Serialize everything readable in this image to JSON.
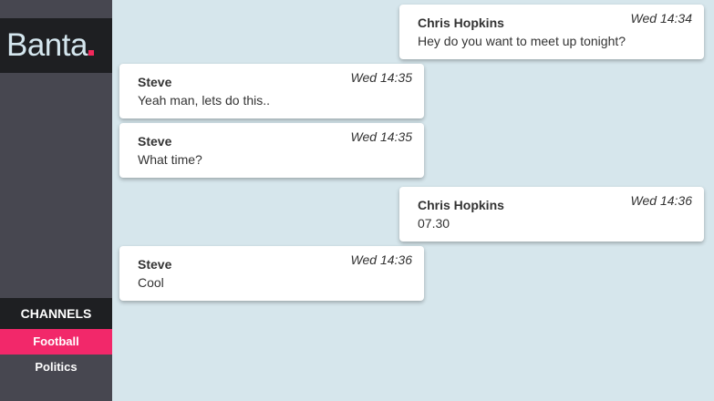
{
  "app": {
    "logo": "Banta",
    "logo_dot_color": "#f2285b"
  },
  "sidebar": {
    "channels_header": "CHANNELS",
    "channels": [
      {
        "label": "Football",
        "active": true
      },
      {
        "label": "Politics",
        "active": false
      }
    ]
  },
  "messages": [
    {
      "author": "Chris Hopkins",
      "time": "Wed 14:34",
      "text": "Hey do you want to meet up tonight?",
      "side": "right"
    },
    {
      "author": "Steve",
      "time": "Wed 14:35",
      "text": "Yeah man, lets do this..",
      "side": "left"
    },
    {
      "author": "Steve",
      "time": "Wed 14:35",
      "text": "What time?",
      "side": "left"
    },
    {
      "author": "Chris Hopkins",
      "time": "Wed 14:36",
      "text": "07.30",
      "side": "right"
    },
    {
      "author": "Steve",
      "time": "Wed 14:36",
      "text": "Cool",
      "side": "left"
    }
  ],
  "colors": {
    "background": "#d6e6ec",
    "sidebar": "#474750",
    "dark_bar": "#1e1f22",
    "accent": "#f2286a"
  }
}
